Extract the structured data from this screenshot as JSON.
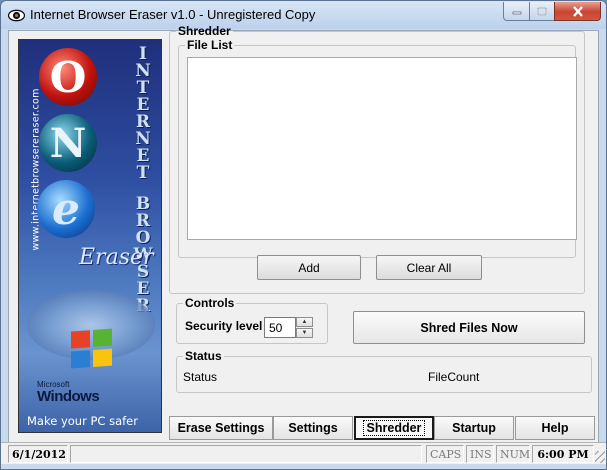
{
  "window": {
    "title": "Internet Browser Eraser v1.0 - Unregistered Copy",
    "controls": {
      "minimize": "minimize-icon",
      "maximize": "maximize-icon",
      "close": "close-icon"
    }
  },
  "banner": {
    "url": "www.internetbrowsereraser.com",
    "vertical_word_1": "INTERNET",
    "vertical_word_2": "BROWSER",
    "eraser": "Eraser",
    "logos": [
      "O",
      "N",
      "e"
    ],
    "ms_text": "Microsoft",
    "windows_text": "Windows",
    "tagline": "Make your PC safer"
  },
  "shredder": {
    "title": "Shredder",
    "file_list_label": "File List",
    "add_label": "Add",
    "clear_all_label": "Clear All"
  },
  "controls": {
    "title": "Controls",
    "security_level_label": "Security level",
    "security_level_value": "50",
    "shred_button_label": "Shred Files Now"
  },
  "status": {
    "title": "Status",
    "status_label": "Status",
    "filecount_label": "FileCount"
  },
  "tabs": [
    {
      "label": "Erase Settings",
      "active": false
    },
    {
      "label": "Settings",
      "active": false
    },
    {
      "label": "Shredder",
      "active": true
    },
    {
      "label": "Startup",
      "active": false
    },
    {
      "label": "Help",
      "active": false
    }
  ],
  "statusbar": {
    "date": "6/1/2012",
    "caps": "CAPS",
    "ins": "INS",
    "num": "NUM",
    "time": "6:00 PM"
  }
}
